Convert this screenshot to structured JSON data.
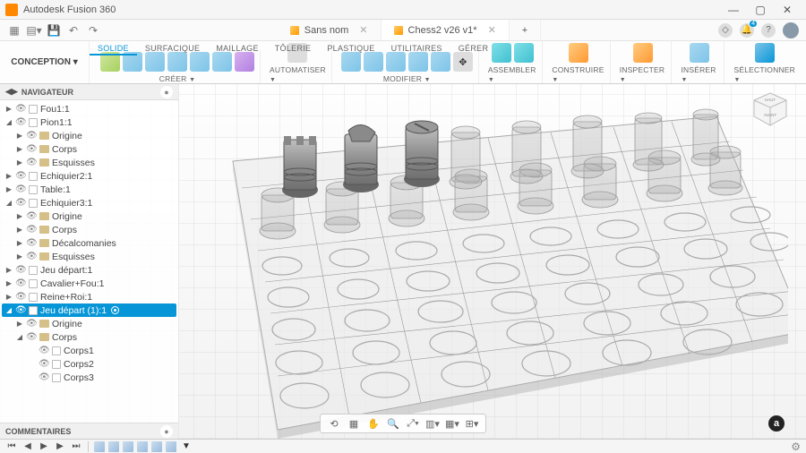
{
  "app": {
    "title": "Autodesk Fusion 360"
  },
  "tabs": [
    {
      "label": "Sans nom",
      "active": false
    },
    {
      "label": "Chess2 v26 v1*",
      "active": true
    }
  ],
  "workspace": {
    "label": "CONCEPTION"
  },
  "ribbonTabs": [
    "SOLIDE",
    "SURFACIQUE",
    "MAILLAGE",
    "TÔLERIE",
    "PLASTIQUE",
    "UTILITAIRES",
    "GÉRER"
  ],
  "ribbonGroups": [
    {
      "label": "CRÉER"
    },
    {
      "label": "AUTOMATISER"
    },
    {
      "label": "MODIFIER"
    },
    {
      "label": ""
    },
    {
      "label": "ASSEMBLER"
    },
    {
      "label": "CONSTRUIRE"
    },
    {
      "label": "INSPECTER"
    },
    {
      "label": "INSÉRER"
    },
    {
      "label": "SÉLECTIONNER"
    }
  ],
  "browser": {
    "title": "NAVIGATEUR",
    "nodes": [
      {
        "depth": 0,
        "expand": "▶",
        "label": "Fou1:1",
        "icon": "comp"
      },
      {
        "depth": 0,
        "expand": "◢",
        "label": "Pion1:1",
        "icon": "comp"
      },
      {
        "depth": 1,
        "expand": "▶",
        "label": "Origine",
        "icon": "folder"
      },
      {
        "depth": 1,
        "expand": "▶",
        "label": "Corps",
        "icon": "folder"
      },
      {
        "depth": 1,
        "expand": "▶",
        "label": "Esquisses",
        "icon": "folder"
      },
      {
        "depth": 0,
        "expand": "▶",
        "label": "Echiquier2:1",
        "icon": "comp"
      },
      {
        "depth": 0,
        "expand": "▶",
        "label": "Table:1",
        "icon": "comp"
      },
      {
        "depth": 0,
        "expand": "◢",
        "label": "Echiquier3:1",
        "icon": "comp"
      },
      {
        "depth": 1,
        "expand": "▶",
        "label": "Origine",
        "icon": "folder"
      },
      {
        "depth": 1,
        "expand": "▶",
        "label": "Corps",
        "icon": "folder"
      },
      {
        "depth": 1,
        "expand": "▶",
        "label": "Décalcomanies",
        "icon": "folder"
      },
      {
        "depth": 1,
        "expand": "▶",
        "label": "Esquisses",
        "icon": "folder"
      },
      {
        "depth": 0,
        "expand": "▶",
        "label": "Jeu départ:1",
        "icon": "comp"
      },
      {
        "depth": 0,
        "expand": "▶",
        "label": "Cavalier+Fou:1",
        "icon": "comp"
      },
      {
        "depth": 0,
        "expand": "▶",
        "label": "Reine+Roi:1",
        "icon": "comp"
      },
      {
        "depth": 0,
        "expand": "◢",
        "label": "Jeu départ (1):1",
        "icon": "comp",
        "selected": true
      },
      {
        "depth": 1,
        "expand": "▶",
        "label": "Origine",
        "icon": "folder"
      },
      {
        "depth": 1,
        "expand": "◢",
        "label": "Corps",
        "icon": "folder"
      },
      {
        "depth": 2,
        "expand": "",
        "label": "Corps1",
        "icon": "comp"
      },
      {
        "depth": 2,
        "expand": "",
        "label": "Corps2",
        "icon": "comp"
      },
      {
        "depth": 2,
        "expand": "",
        "label": "Corps3",
        "icon": "comp"
      }
    ]
  },
  "comments": {
    "title": "COMMENTAIRES"
  },
  "viewcube": {
    "front": "AVANT",
    "top": "HAUT"
  },
  "notifications": {
    "count": "4"
  }
}
